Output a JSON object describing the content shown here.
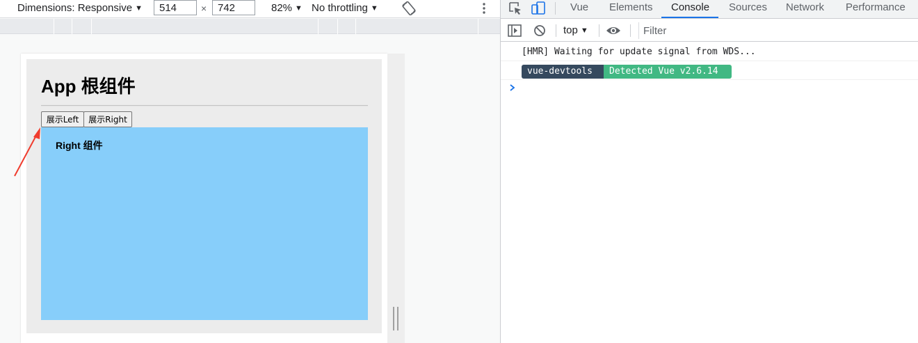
{
  "device_toolbar": {
    "dimensions_label": "Dimensions: Responsive",
    "width_value": "514",
    "height_value": "742",
    "times": "×",
    "zoom_label": "82%",
    "throttling_label": "No throttling",
    "caret": "▼"
  },
  "page": {
    "app_title": "App 根组件",
    "buttons": [
      "展示Left",
      "展示Right"
    ],
    "right_component_title": "Right 组件",
    "colors": {
      "app_background": "#ececec",
      "right_component_background": "#87cefa",
      "annotation_arrow": "#f03c2e"
    }
  },
  "devtools": {
    "tabs": [
      "Vue",
      "Elements",
      "Console",
      "Sources",
      "Network",
      "Performance"
    ],
    "active_tab": "Console",
    "context_label": "top",
    "filter_placeholder": "Filter",
    "console_messages": {
      "hmr": "[HMR] Waiting for update signal from WDS...",
      "badge_left": "vue-devtools",
      "badge_right": "Detected Vue v2.6.14"
    },
    "colors": {
      "accent": "#1a73e8",
      "badge_left": "#35495e",
      "badge_right": "#41b883"
    },
    "icons": [
      "inspect-element-icon",
      "device-toolbar-icon",
      "sidebar-toggle-icon",
      "clear-console-icon",
      "live-expression-eye-icon",
      "console-prompt-icon",
      "rotate-icon",
      "more-options-icon"
    ]
  }
}
